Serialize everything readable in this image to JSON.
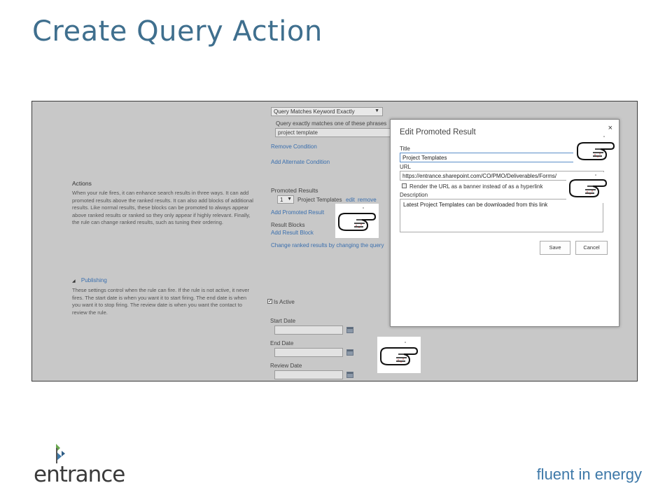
{
  "slide": {
    "title": "Create Query Action",
    "tagline": "fluent in energy",
    "logo_text": "entrance"
  },
  "sharepoint": {
    "condition_select": "Query Matches Keyword Exactly",
    "condition_label": "Query exactly matches one of these phrases",
    "condition_value": "project template",
    "remove_condition": "Remove Condition",
    "add_alternate": "Add Alternate Condition",
    "actions_heading": "Actions",
    "actions_desc": "When your rule fires, it can enhance search results in three ways. It can add promoted results above the ranked results. It can also add blocks of additional results. Like normal results, these blocks can be promoted to always appear above ranked results or ranked so they only appear if highly relevant. Finally, the rule can change ranked results, such as tuning their ordering.",
    "promoted_heading": "Promoted Results",
    "promoted_rank": "1",
    "promoted_item": "Project Templates",
    "promoted_edit": "edit",
    "promoted_remove": "remove",
    "add_promoted": "Add Promoted Result",
    "result_blocks": "Result Blocks",
    "add_block": "Add Result Block",
    "change_ranked": "Change ranked results by changing the query",
    "publishing_heading": "Publishing",
    "publishing_desc": "These settings control when the rule can fire. If the rule is not active, it never fires. The start date is when you want it to start firing. The end date is when you want it to stop firing. The review date is when you want the contact to review the rule.",
    "is_active": "Is Active",
    "start_date": "Start Date",
    "end_date": "End Date",
    "review_date": "Review Date"
  },
  "dialog": {
    "title": "Edit Promoted Result",
    "close": "×",
    "title_label": "Title",
    "title_value": "Project Templates",
    "url_label": "URL",
    "url_value": "https://entrance.sharepoint.com/CO/PMO/Deliverables/Forms/",
    "banner_checkbox": "Render the URL as a banner instead of as a hyperlink",
    "description_label": "Description",
    "description_value": "Latest Project Templates can be downloaded from this link",
    "save": "Save",
    "cancel": "Cancel"
  },
  "colors": {
    "title_blue": "#3f6f8e",
    "tagline_blue": "#3d78a8",
    "link_blue": "#3a6fae",
    "overlay_gray": "#c8c8c8"
  },
  "icons": [
    "pointing-hand-icon",
    "calendar-icon",
    "triangle-expander-icon",
    "dropdown-arrow-icon",
    "close-icon"
  ]
}
